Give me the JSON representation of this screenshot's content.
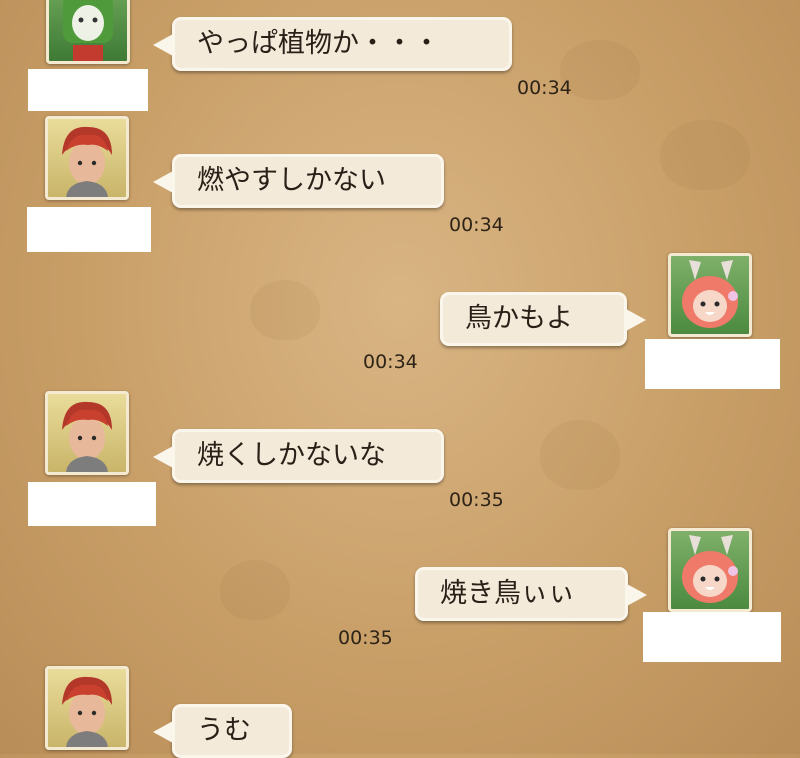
{
  "messages": [
    {
      "side": "left",
      "avatar": "green-masked-character",
      "text": "やっぱ植物か・・・",
      "time": "00:34"
    },
    {
      "side": "left",
      "avatar": "red-haired-character",
      "text": "燃やすしかない",
      "time": "00:34"
    },
    {
      "side": "right",
      "avatar": "pink-haired-character",
      "text": "鳥かもよ",
      "time": "00:34"
    },
    {
      "side": "left",
      "avatar": "red-haired-character",
      "text": "焼くしかないな",
      "time": "00:35"
    },
    {
      "side": "right",
      "avatar": "pink-haired-character",
      "text": "焼き鳥ぃぃ",
      "time": "00:35"
    },
    {
      "side": "left",
      "avatar": "red-haired-character",
      "text": "うむ",
      "time": ""
    }
  ],
  "colors": {
    "background": "#c99f68",
    "bubble": "#f4ead9",
    "bubble_border": "#fbf6ec",
    "text": "#2b2018"
  }
}
